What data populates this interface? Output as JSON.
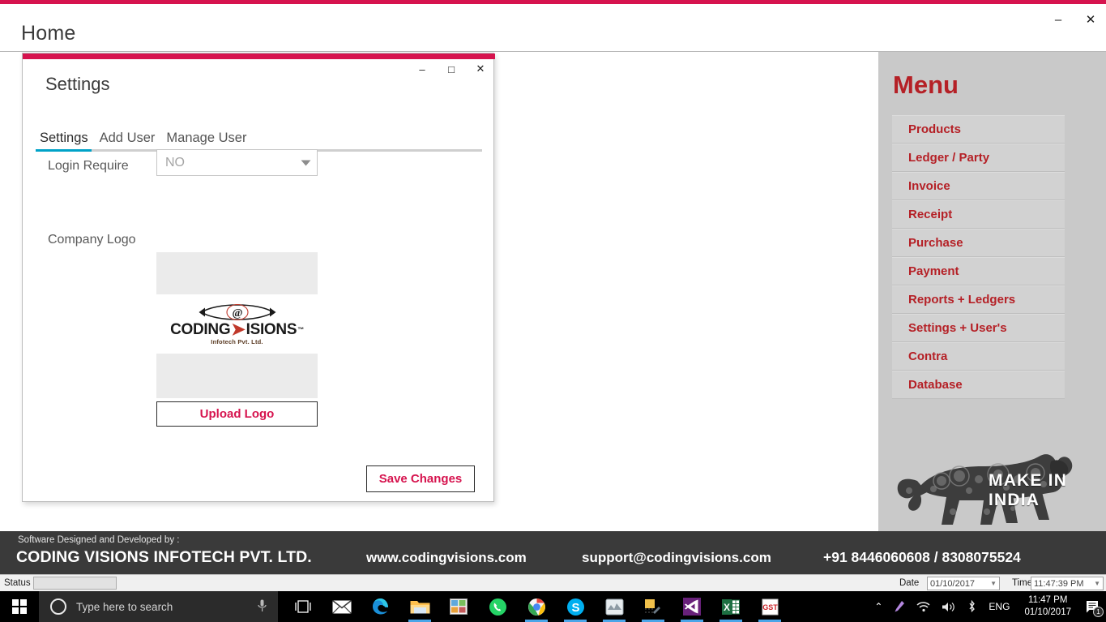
{
  "window": {
    "title": "Home",
    "minimize_label": "–",
    "close_label": "✕",
    "accent_color": "#d6134e"
  },
  "dialog": {
    "title": "Settings",
    "minimize_label": "–",
    "maximize_label": "□",
    "close_label": "✕",
    "tabs": [
      {
        "label": "Settings",
        "active": true
      },
      {
        "label": "Add User",
        "active": false
      },
      {
        "label": "Manage User",
        "active": false
      }
    ],
    "active_tab_indicator_color": "#00a2c8",
    "fields": {
      "login_require_label": "Login Require",
      "login_require_value": "NO",
      "company_logo_label": "Company Logo"
    },
    "logo": {
      "word_part1": "CODING",
      "word_arrow": "➤",
      "word_part2": "ISIONS",
      "trademark": "™",
      "subtitle": "Infotech Pvt. Ltd.",
      "at_symbol": "@"
    },
    "upload_button": "Upload Logo",
    "save_button": "Save Changes",
    "button_text_color": "#d6134e"
  },
  "sidebar": {
    "title": "Menu",
    "title_color": "#b52026",
    "items": [
      {
        "label": "Products"
      },
      {
        "label": "Ledger / Party"
      },
      {
        "label": "Invoice"
      },
      {
        "label": "Receipt"
      },
      {
        "label": "Purchase"
      },
      {
        "label": "Payment"
      },
      {
        "label": "Reports + Ledgers"
      },
      {
        "label": "Settings + User's"
      },
      {
        "label": "Contra"
      },
      {
        "label": "Database"
      }
    ],
    "banner_text": "MAKE IN INDIA"
  },
  "footer": {
    "credit_line": "Software Designed and Developed by :",
    "company": "CODING VISIONS INFOTECH PVT. LTD.",
    "website": "www.codingvisions.com",
    "email": "support@codingvisions.com",
    "phone": "+91 8446060608 / 8308075524"
  },
  "status_bar": {
    "status_label": "Status",
    "status_value": "",
    "date_label": "Date",
    "date_value": "01/10/2017",
    "time_label": "Time",
    "time_value": "11:47:39 PM"
  },
  "taskbar": {
    "start_icon": "windows-logo-icon",
    "search_placeholder": "Type here to search",
    "cortana_icon": "cortana-circle-icon",
    "mic_icon": "microphone-icon",
    "apps": [
      {
        "name": "task-view-icon"
      },
      {
        "name": "mail-icon"
      },
      {
        "name": "edge-browser-icon"
      },
      {
        "name": "file-explorer-icon"
      },
      {
        "name": "photos-icon"
      },
      {
        "name": "whatsapp-icon"
      },
      {
        "name": "chrome-icon"
      },
      {
        "name": "skype-icon"
      },
      {
        "name": "media-player-icon"
      },
      {
        "name": "snipping-tool-icon"
      },
      {
        "name": "visual-studio-icon"
      },
      {
        "name": "excel-icon"
      },
      {
        "name": "gst-app-icon"
      }
    ],
    "tray": {
      "chevron": "⌃",
      "pen_icon": "pen-icon",
      "network_icon": "wifi-icon",
      "volume_icon": "speaker-icon",
      "bluetooth_icon": "bluetooth-icon",
      "language": "ENG",
      "clock_time": "11:47 PM",
      "clock_date": "01/10/2017",
      "notification_count": "1"
    }
  }
}
